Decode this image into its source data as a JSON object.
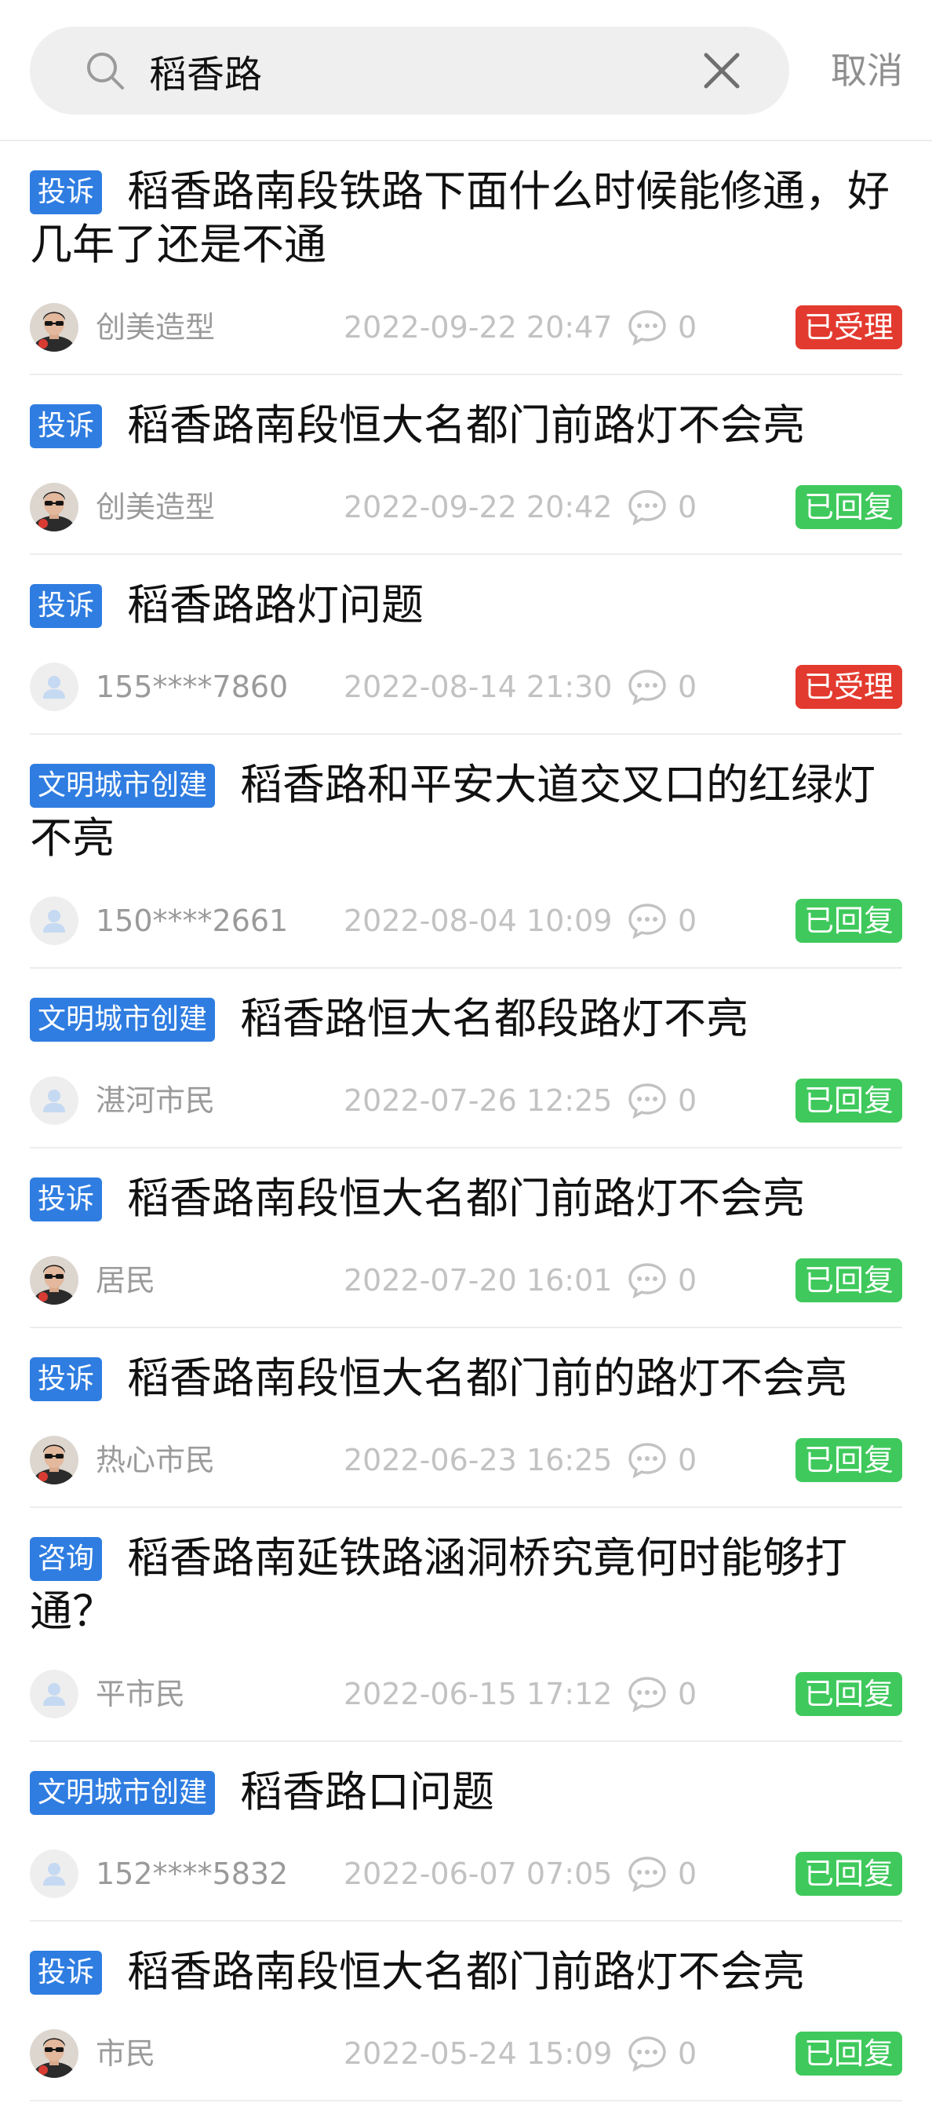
{
  "search": {
    "value": "稻香路",
    "cancel_label": "取消"
  },
  "colors": {
    "tag_blue": "#2f7de1",
    "status_red": "#e33a2f",
    "status_green": "#3fc95c",
    "muted_text": "#9a9a9a"
  },
  "results": [
    {
      "tag": "投诉",
      "title": "稻香路南段铁路下面什么时候能修通，好几年了还是不通",
      "lines": 2,
      "author": "创美造型",
      "avatar": "photo-avatar",
      "time": "2022-09-22 20:47",
      "comments": "0",
      "status": "已受理",
      "status_color": "#e33a2f"
    },
    {
      "tag": "投诉",
      "title": "稻香路南段恒大名都门前路灯不会亮",
      "lines": 1,
      "author": "创美造型",
      "avatar": "photo-avatar",
      "time": "2022-09-22 20:42",
      "comments": "0",
      "status": "已回复",
      "status_color": "#3fc95c"
    },
    {
      "tag": "投诉",
      "title": "稻香路路灯问题",
      "lines": 1,
      "author": "155****7860",
      "avatar": "default-user-icon",
      "time": "2022-08-14 21:30",
      "comments": "0",
      "status": "已受理",
      "status_color": "#e33a2f"
    },
    {
      "tag": "文明城市创建",
      "title": "稻香路和平安大道交叉口的红绿灯不亮",
      "lines": 2,
      "author": "150****2661",
      "avatar": "default-user-icon",
      "time": "2022-08-04 10:09",
      "comments": "0",
      "status": "已回复",
      "status_color": "#3fc95c"
    },
    {
      "tag": "文明城市创建",
      "title": "稻香路恒大名都段路灯不亮",
      "lines": 1,
      "author": "湛河市民",
      "avatar": "default-user-icon",
      "time": "2022-07-26 12:25",
      "comments": "0",
      "status": "已回复",
      "status_color": "#3fc95c"
    },
    {
      "tag": "投诉",
      "title": "稻香路南段恒大名都门前路灯不会亮",
      "lines": 1,
      "author": "居民",
      "avatar": "photo-avatar",
      "time": "2022-07-20 16:01",
      "comments": "0",
      "status": "已回复",
      "status_color": "#3fc95c"
    },
    {
      "tag": "投诉",
      "title": "稻香路南段恒大名都门前的路灯不会亮",
      "lines": 1,
      "author": "热心市民",
      "avatar": "photo-avatar",
      "time": "2022-06-23 16:25",
      "comments": "0",
      "status": "已回复",
      "status_color": "#3fc95c"
    },
    {
      "tag": "咨询",
      "title": "稻香路南延铁路涵洞桥究竟何时能够打通？",
      "lines": 2,
      "author": "平市民",
      "avatar": "default-user-icon",
      "time": "2022-06-15 17:12",
      "comments": "0",
      "status": "已回复",
      "status_color": "#3fc95c"
    },
    {
      "tag": "文明城市创建",
      "title": "稻香路口问题",
      "lines": 1,
      "author": "152****5832",
      "avatar": "default-user-icon",
      "time": "2022-06-07 07:05",
      "comments": "0",
      "status": "已回复",
      "status_color": "#3fc95c"
    },
    {
      "tag": "投诉",
      "title": "稻香路南段恒大名都门前路灯不会亮",
      "lines": 1,
      "author": "市民",
      "avatar": "photo-avatar",
      "time": "2022-05-24 15:09",
      "comments": "0",
      "status": "已回复",
      "status_color": "#3fc95c"
    }
  ]
}
